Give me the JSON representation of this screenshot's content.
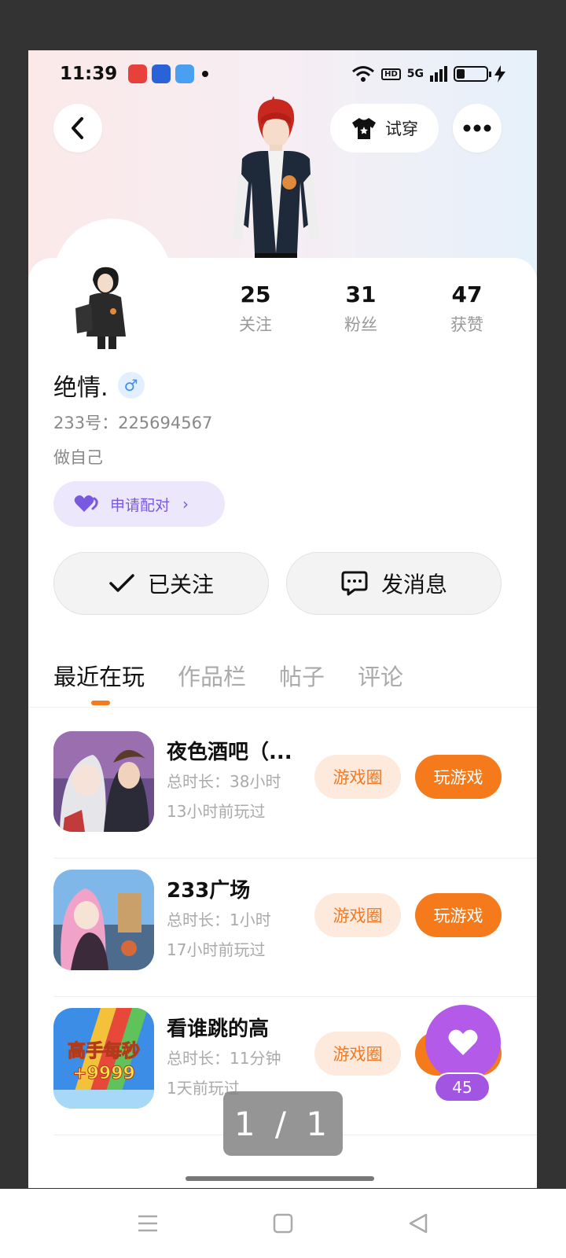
{
  "status_bar": {
    "time": "11:39",
    "network": "5G",
    "hd": "HD"
  },
  "header": {
    "tryon_label": "试穿"
  },
  "stats": [
    {
      "value": "25",
      "label": "关注"
    },
    {
      "value": "31",
      "label": "粉丝"
    },
    {
      "value": "47",
      "label": "获赞"
    }
  ],
  "profile": {
    "name": "绝情.",
    "gender_symbol": "♂",
    "uid": "233号：225694567",
    "bio": "做自己",
    "pair_label": "申请配对"
  },
  "actions": {
    "follow_label": "已关注",
    "message_label": "发消息"
  },
  "tabs": [
    "最近在玩",
    "作品栏",
    "帖子",
    "评论"
  ],
  "games": [
    {
      "title": "夜色酒吧（...",
      "duration": "总时长：38小时",
      "last_played": "13小时前玩过",
      "circle_label": "游戏圈",
      "play_label": "玩游戏"
    },
    {
      "title": "233广场",
      "duration": "总时长：1小时",
      "last_played": "17小时前玩过",
      "circle_label": "游戏圈",
      "play_label": "玩游戏"
    },
    {
      "title": "看谁跳的高",
      "duration": "总时长：11分钟",
      "last_played": "1天前玩过",
      "circle_label": "游戏圈",
      "play_label": "玩游戏",
      "icon_text_top": "高手每秒",
      "icon_text_bottom": "+9999"
    }
  ],
  "like_count": "45",
  "page_counter": "1 / 1",
  "colors": {
    "accent": "#f57a1c",
    "purple": "#b35ae8",
    "pair_bg": "#ece7fb"
  }
}
